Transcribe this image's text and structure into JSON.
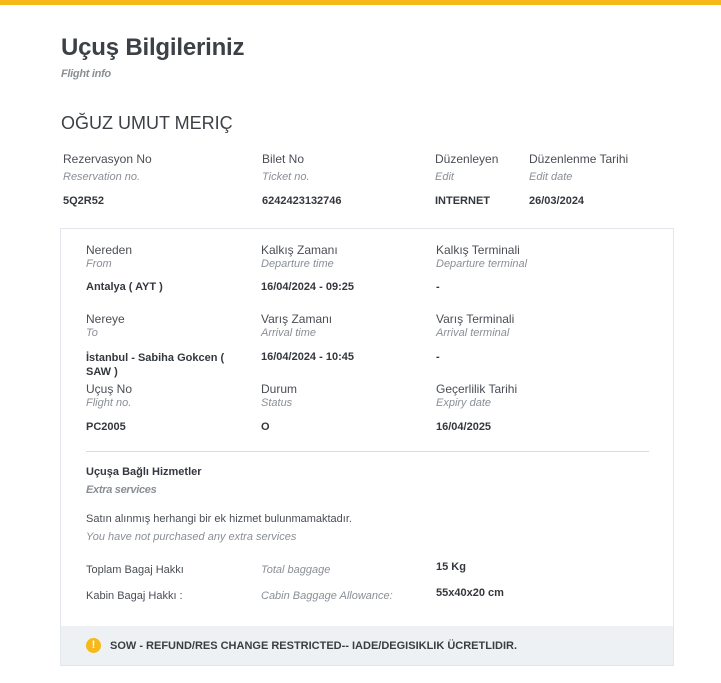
{
  "header": {
    "title": "Uçuş Bilgileriniz",
    "subtitle": "Flight info"
  },
  "passenger_name": "OĞUZ UMUT MERIÇ",
  "reservation": {
    "columns": [
      {
        "label": "Rezervasyon No",
        "sub": "Reservation no.",
        "value": "5Q2R52"
      },
      {
        "label": "Bilet No",
        "sub": "Ticket no.",
        "value": "6242423132746"
      },
      {
        "label": "Düzenleyen",
        "sub": "Edit",
        "value": "INTERNET"
      },
      {
        "label": "Düzenlenme Tarihi",
        "sub": "Edit date",
        "value": "26/03/2024"
      }
    ]
  },
  "flight": {
    "from": {
      "label": "Nereden",
      "sub": "From",
      "value": "Antalya ( AYT )"
    },
    "departure_time": {
      "label": "Kalkış Zamanı",
      "sub": "Departure time",
      "value": "16/04/2024 - 09:25"
    },
    "departure_terminal": {
      "label": "Kalkış Terminali",
      "sub": "Departure terminal",
      "value": "-"
    },
    "to": {
      "label": "Nereye",
      "sub": "To",
      "value": "İstanbul - Sabiha Gokcen ( SAW )"
    },
    "arrival_time": {
      "label": "Varış Zamanı",
      "sub": "Arrival time",
      "value": "16/04/2024 - 10:45"
    },
    "arrival_terminal": {
      "label": "Varış Terminali",
      "sub": "Arrival terminal",
      "value": "-"
    },
    "flight_no": {
      "label": "Uçuş No",
      "sub": "Flight no.",
      "value": "PC2005"
    },
    "status": {
      "label": "Durum",
      "sub": "Status",
      "value": "O"
    },
    "expiry": {
      "label": "Geçerlilik Tarihi",
      "sub": "Expiry date",
      "value": "16/04/2025"
    }
  },
  "extra_services": {
    "title": "Uçuşa Bağlı Hizmetler",
    "subtitle": "Extra services",
    "none_text": "Satın alınmış herhangi bir ek hizmet bulunmamaktadır.",
    "none_sub": "You have not purchased any extra services"
  },
  "baggage": {
    "total": {
      "label": "Toplam Bagaj Hakkı",
      "sub": "Total baggage",
      "value": "15 Kg"
    },
    "cabin": {
      "label": "Kabin Bagaj Hakkı :",
      "sub": "Cabin Baggage Allowance:",
      "value": "55x40x20 cm"
    }
  },
  "notice": {
    "icon": "warning-icon",
    "icon_glyph": "!",
    "text": "SOW - REFUND/RES CHANGE RESTRICTED-- IADE/DEGISIKLIK ÜCRETLIDIR.",
    "accent_color": "#f6b919"
  }
}
